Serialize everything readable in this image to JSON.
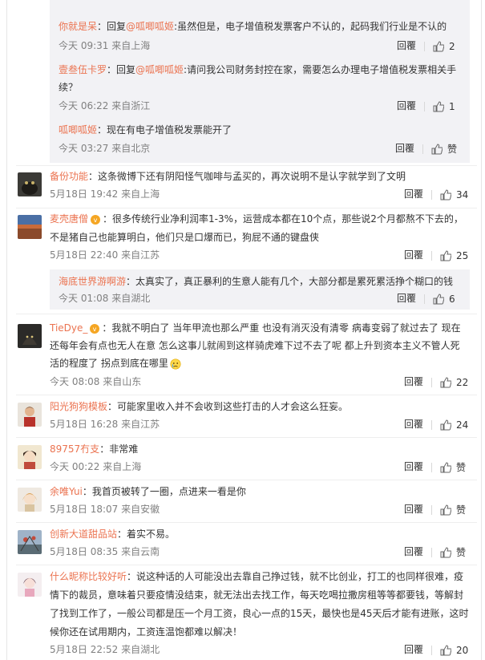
{
  "nested_replies": [
    {
      "user": "你就是呆",
      "text": "：回复",
      "mention": "@呱唧呱姬",
      "content": ":虽然但是，电子增值税发票客户不认的，起码我们行业是不认的",
      "time": "今天 09:31",
      "source": "来自上海",
      "reply": "回覆",
      "likes": "2"
    },
    {
      "user": "壹叁伍卡罗",
      "text": "：回复",
      "mention": "@呱唧呱姬",
      "content": ":请问我公司财务封控在家，需要怎么办理电子增值税发票相关手",
      "content2": "续？",
      "time": "今天 06:22",
      "source": "来自浙江",
      "reply": "回覆",
      "likes": "1"
    },
    {
      "user": "呱唧呱姬",
      "text": "：现在有电子增值税发票能开了",
      "time": "今天 03:27",
      "source": "来自北京",
      "reply": "回覆",
      "likes": "赞"
    }
  ],
  "comments": [
    {
      "user": "备份功能",
      "content": "：这条微博下还有阴阳怪气咖啡与孟买的，再次说明不是认字就学到了文明",
      "time": "5月18日 19:42",
      "source": "来自上海",
      "reply": "回覆",
      "likes": "34"
    },
    {
      "user": "麦壳唐僧",
      "content": "：很多传统行业净利润率1-3%，运营成本都在10个点，那些说2个月都熬不下去的，",
      "content2": "不是猪自己也能算明白，他们只是口爆而已，狗屁不通的键盘侠",
      "time": "5月18日 22:40",
      "source": "来自江苏",
      "reply": "回覆",
      "likes": "25"
    },
    {
      "user": "TieDye_",
      "content": "：我就不明白了 当年甲流也那么严重 也没有消灭没有清零 病毒变弱了就过去了 现在",
      "content2": "还每年会有点也无人在意 怎么这事儿就闹到这样骑虎难下过不去了呢 都上升到资本主义不管人死",
      "content3": "活的程度了 拐点到底在哪里",
      "time": "今天 08:08",
      "source": "来自山东",
      "reply": "回覆",
      "likes": "22"
    },
    {
      "user": "阳光狗狗模板",
      "content": "：可能家里收入并不会收到这些打击的人才会这么狂妄。",
      "time": "5月18日 16:28",
      "source": "来自江苏",
      "reply": "回覆",
      "likes": "24"
    },
    {
      "user": "89757冇支",
      "content": "：非常难",
      "time": "今天 00:22",
      "source": "来自上海",
      "reply": "回覆",
      "likes": "赞"
    },
    {
      "user": "余唯Yui",
      "content": "：我首页被转了一圈，点进来一看是你",
      "time": "5月18日 18:07",
      "source": "来自安徽",
      "reply": "回覆",
      "likes": "赞"
    },
    {
      "user": "创新大道甜品站",
      "content": "：着实不易。",
      "time": "5月18日 08:35",
      "source": "来自云南",
      "reply": "回覆",
      "likes": "赞"
    },
    {
      "user": "什么昵称比较好听",
      "content": "：说这种话的人可能没出去靠自己挣过钱，就不比创业，打工的也同样很难，疫",
      "content2": "情下的裁员，意味着只要疫情没结束，就无法出去找工作，每天吃喝拉撒房租等等都要钱，等解封",
      "content3": "了找到工作了，一般公司都是压一个月工资，良心一点的15天，最快也是45天后才能有进账，这时",
      "content4": "候你还在试用期内，工资连温饱都难以解决！",
      "time": "5月18日 22:52",
      "source": "来自湖北",
      "reply": "回覆",
      "likes": "20"
    }
  ],
  "nested_reply_mid": {
    "user": "海底世界游啊游",
    "content": "：太真实了，真正暴利的生意人能有几个，大部分都是累死累活挣个糊口的钱",
    "time": "今天 01:08",
    "source": "来自湖北",
    "reply": "回覆",
    "likes": "6"
  },
  "colors": {
    "username": "#eb7350",
    "meta": "#808080",
    "nested_bg": "#f2f2f5"
  }
}
